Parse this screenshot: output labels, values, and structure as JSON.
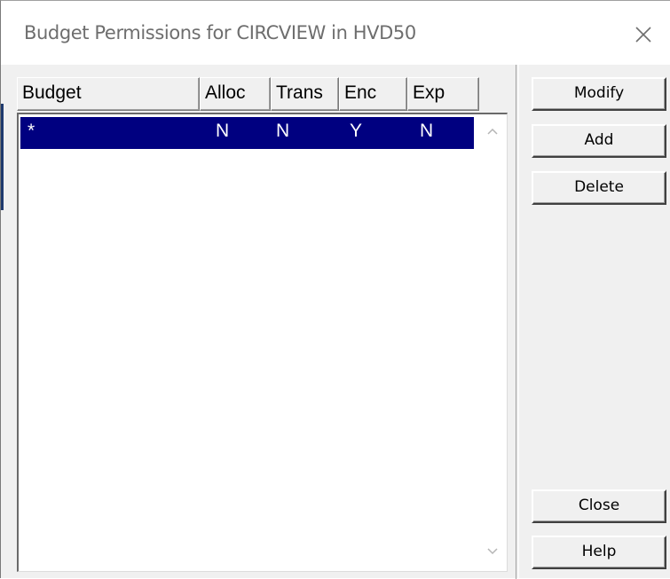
{
  "window": {
    "title": "Budget Permissions for CIRCVIEW in HVD50",
    "close_icon": "close-icon"
  },
  "list": {
    "columns": [
      "Budget",
      "Alloc",
      "Trans",
      "Enc",
      "Exp"
    ],
    "rows": [
      {
        "budget": "*",
        "alloc": "N",
        "trans": "N",
        "enc": "Y",
        "exp": "N",
        "selected": true
      }
    ],
    "selection_color": "#000080"
  },
  "buttons": {
    "modify": "Modify",
    "add": "Add",
    "delete": "Delete",
    "close": "Close",
    "help": "Help"
  },
  "icons": {
    "scroll_up": "chevron-up-icon",
    "scroll_down": "chevron-down-icon"
  }
}
